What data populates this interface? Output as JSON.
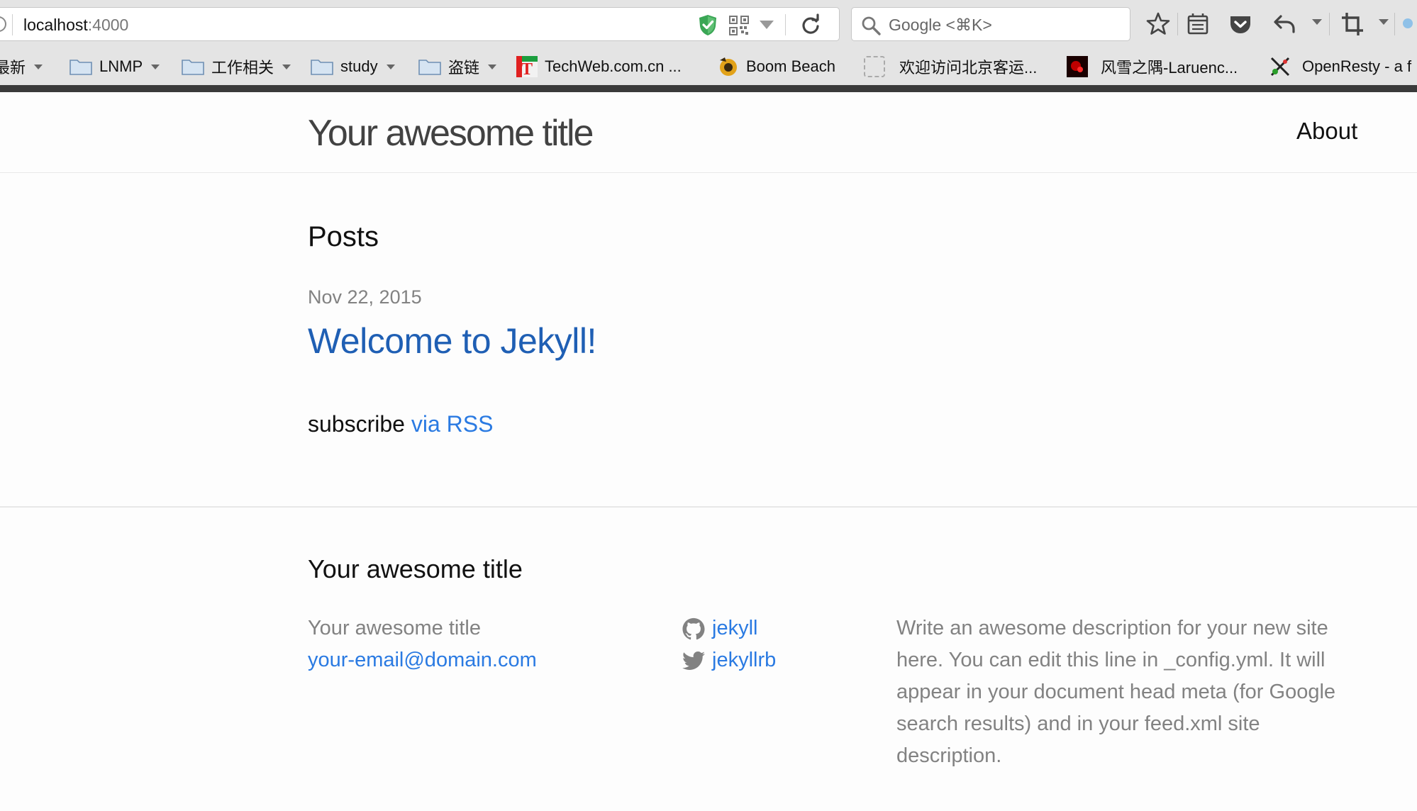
{
  "browser": {
    "url_host": "localhost",
    "url_port": ":4000",
    "search_placeholder": "Google <⌘K>",
    "bookmarks": [
      {
        "label": "最新",
        "type": "folder"
      },
      {
        "label": "LNMP",
        "type": "folder"
      },
      {
        "label": "工作相关",
        "type": "folder"
      },
      {
        "label": "study",
        "type": "folder"
      },
      {
        "label": "盗链",
        "type": "folder"
      },
      {
        "label": "TechWeb.com.cn ...",
        "type": "link"
      },
      {
        "label": "Boom Beach",
        "type": "link"
      },
      {
        "label": "欢迎访问北京客运...",
        "type": "link"
      },
      {
        "label": "风雪之隅-Laruenc...",
        "type": "link"
      },
      {
        "label": "OpenResty - a f",
        "type": "link"
      }
    ]
  },
  "header": {
    "site_title": "Your awesome title",
    "nav_about": "About"
  },
  "main": {
    "posts_heading": "Posts",
    "posts": [
      {
        "date": "Nov 22, 2015",
        "title": "Welcome to Jekyll!"
      }
    ],
    "rss_prefix": "subscribe",
    "rss_link": "via RSS"
  },
  "footer": {
    "heading": "Your awesome title",
    "name": "Your awesome title",
    "email": "your-email@domain.com",
    "github_user": "jekyll",
    "twitter_user": "jekyllrb",
    "description": "Write an awesome description for your new site here. You can edit this line in _config.yml. It will appear in your document head meta (for Google search results) and in your feed.xml site description."
  },
  "colors": {
    "link": "#2a7ae2",
    "meta_grey": "#828282",
    "text": "#111111",
    "page_bg": "#fdfdfd"
  }
}
